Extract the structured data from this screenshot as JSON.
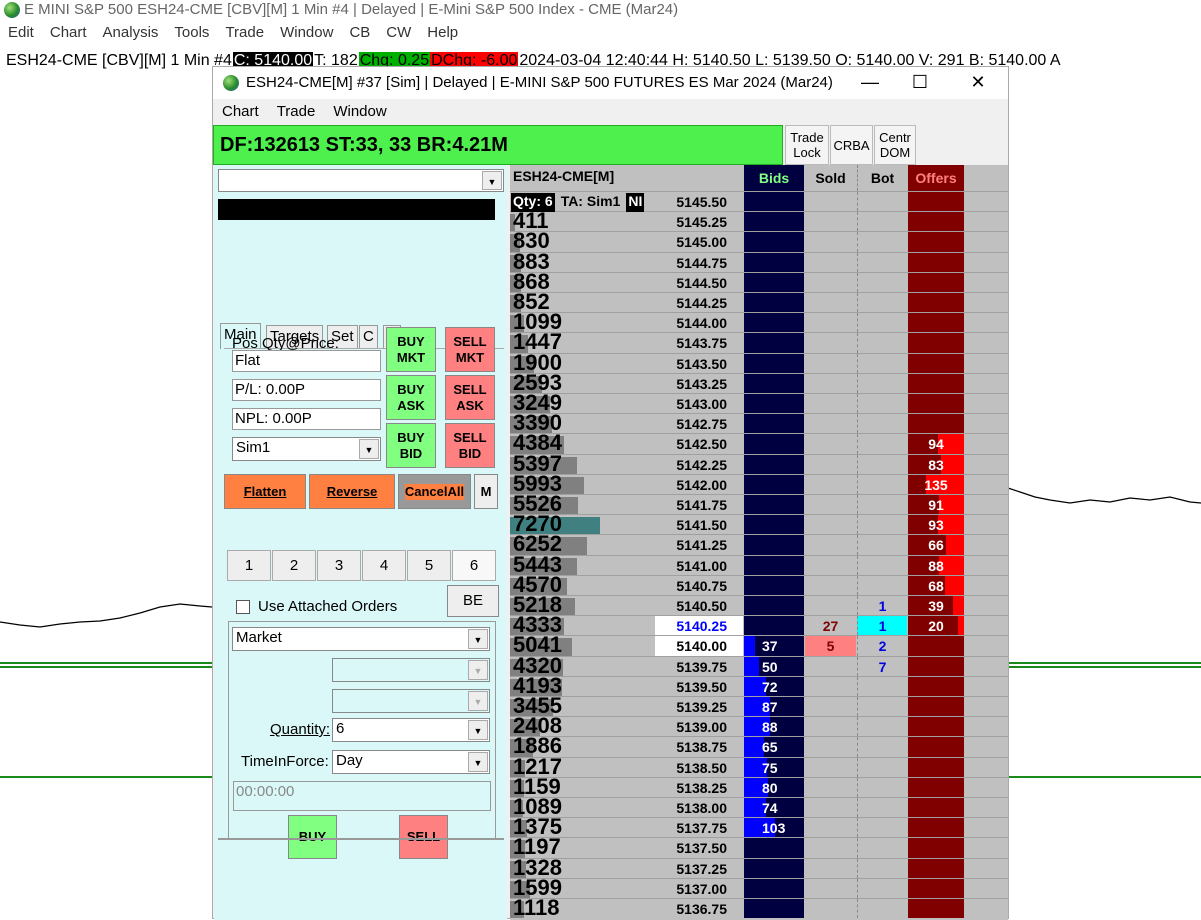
{
  "app": {
    "title": "E MINI S&P 500 ESH24-CME [CBV][M]  1 Min  #4 | Delayed | E-Mini S&P 500 Index - CME (Mar24)",
    "menu": [
      "Edit",
      "Chart",
      "Analysis",
      "Tools",
      "Trade",
      "Window",
      "CB",
      "CW",
      "Help"
    ],
    "chart_info": {
      "symbol": "ESH24-CME [CBV][M]  1 Min  #4",
      "close": "C: 5140.00",
      "ticks": "T: 182",
      "chg": "Chg: 0.25",
      "dchg": "DChg: -6.00",
      "rest": "2024-03-04 12:40:44 H: 5140.50 L: 5139.50 O: 5140.00 V: 291 B: 5140.00 A"
    },
    "colors": {
      "chg": "#00b000",
      "dchg": "#ff0000"
    }
  },
  "dom_window": {
    "title": "ESH24-CME[M] #37 [Sim]  | Delayed | E-MINI S&P 500 FUTURES ES Mar 2024 (Mar24)",
    "controls": [
      "—",
      "☐",
      "✕"
    ],
    "menu": [
      "Chart",
      "Trade",
      "Window"
    ],
    "status": "DF:132613  ST:33, 33  BR:4.21M",
    "top_buttons": [
      {
        "l1": "Trade",
        "l2": "Lock"
      },
      {
        "l1": "CRBA",
        "l2": ""
      },
      {
        "l1": "Centr",
        "l2": "DOM"
      }
    ]
  },
  "panel": {
    "tabs": [
      "Main",
      "Targets",
      "Set",
      "C",
      "A"
    ],
    "pos_label": "Pos Qty@Price:",
    "pos": "Flat",
    "pl": "P/L: 0.00P",
    "npl": "NPL: 0.00P",
    "account": "Sim1",
    "buy_mkt": [
      "BUY",
      "MKT"
    ],
    "sell_mkt": [
      "SELL",
      "MKT"
    ],
    "buy_ask": [
      "BUY",
      "ASK"
    ],
    "sell_ask": [
      "SELL",
      "ASK"
    ],
    "buy_bid": [
      "BUY",
      "BID"
    ],
    "sell_bid": [
      "SELL",
      "BID"
    ],
    "flatten": "Flatten",
    "reverse": "Reverse",
    "cancel_all": "CancelAll",
    "m": "M",
    "qty_presets": [
      "1",
      "2",
      "3",
      "4",
      "5",
      "6"
    ],
    "attached": "Use Attached Orders",
    "be": "BE",
    "order_type": "Market",
    "quantity_label": "Quantity:",
    "quantity": "6",
    "tif_label": "TimeInForce:",
    "tif": "Day",
    "time": "00:00:00",
    "buy": "BUY",
    "sell": "SELL"
  },
  "dom": {
    "symbol": "ESH24-CME[M]",
    "headers": {
      "bids": "Bids",
      "sold": "Sold",
      "bot": "Bot",
      "offers": "Offers"
    },
    "overlay": {
      "qty": "Qty: 6",
      "ta": "TA: Sim1",
      "ni": "NI"
    },
    "ask_price": "5140.25",
    "bid_price": "5140.00",
    "max_volume": 7270,
    "max_depth": 200,
    "rows": [
      {
        "v": null,
        "p": "5145.50"
      },
      {
        "v": "411",
        "p": "5145.25"
      },
      {
        "v": "830",
        "p": "5145.00"
      },
      {
        "v": "883",
        "p": "5144.75"
      },
      {
        "v": "868",
        "p": "5144.50"
      },
      {
        "v": "852",
        "p": "5144.25"
      },
      {
        "v": "1099",
        "p": "5144.00"
      },
      {
        "v": "1447",
        "p": "5143.75"
      },
      {
        "v": "1900",
        "p": "5143.50"
      },
      {
        "v": "2593",
        "p": "5143.25"
      },
      {
        "v": "3249",
        "p": "5143.00"
      },
      {
        "v": "3390",
        "p": "5142.75"
      },
      {
        "v": "4384",
        "p": "5142.50",
        "o": "94"
      },
      {
        "v": "5397",
        "p": "5142.25",
        "o": "83"
      },
      {
        "v": "5993",
        "p": "5142.00",
        "o": "135"
      },
      {
        "v": "5526",
        "p": "5141.75",
        "o": "91"
      },
      {
        "v": "7270",
        "p": "5141.50",
        "o": "93"
      },
      {
        "v": "6252",
        "p": "5141.25",
        "o": "66"
      },
      {
        "v": "5443",
        "p": "5141.00",
        "o": "88"
      },
      {
        "v": "4570",
        "p": "5140.75",
        "o": "68"
      },
      {
        "v": "5218",
        "p": "5140.50",
        "t": "1",
        "o": "39"
      },
      {
        "v": "4333",
        "p": "5140.25",
        "s": "27",
        "t": "1",
        "o": "20"
      },
      {
        "v": "5041",
        "p": "5140.00",
        "b": "37",
        "s": "5",
        "t": "2"
      },
      {
        "v": "4320",
        "p": "5139.75",
        "b": "50",
        "t": "7"
      },
      {
        "v": "4193",
        "p": "5139.50",
        "b": "72"
      },
      {
        "v": "3455",
        "p": "5139.25",
        "b": "87"
      },
      {
        "v": "2408",
        "p": "5139.00",
        "b": "88"
      },
      {
        "v": "1886",
        "p": "5138.75",
        "b": "65"
      },
      {
        "v": "1217",
        "p": "5138.50",
        "b": "75"
      },
      {
        "v": "1159",
        "p": "5138.25",
        "b": "80"
      },
      {
        "v": "1089",
        "p": "5138.00",
        "b": "74"
      },
      {
        "v": "1375",
        "p": "5137.75",
        "b": "103"
      },
      {
        "v": "1197",
        "p": "5137.50"
      },
      {
        "v": "1328",
        "p": "5137.25"
      },
      {
        "v": "1599",
        "p": "5137.00"
      },
      {
        "v": "1118",
        "p": "5136.75"
      }
    ]
  }
}
